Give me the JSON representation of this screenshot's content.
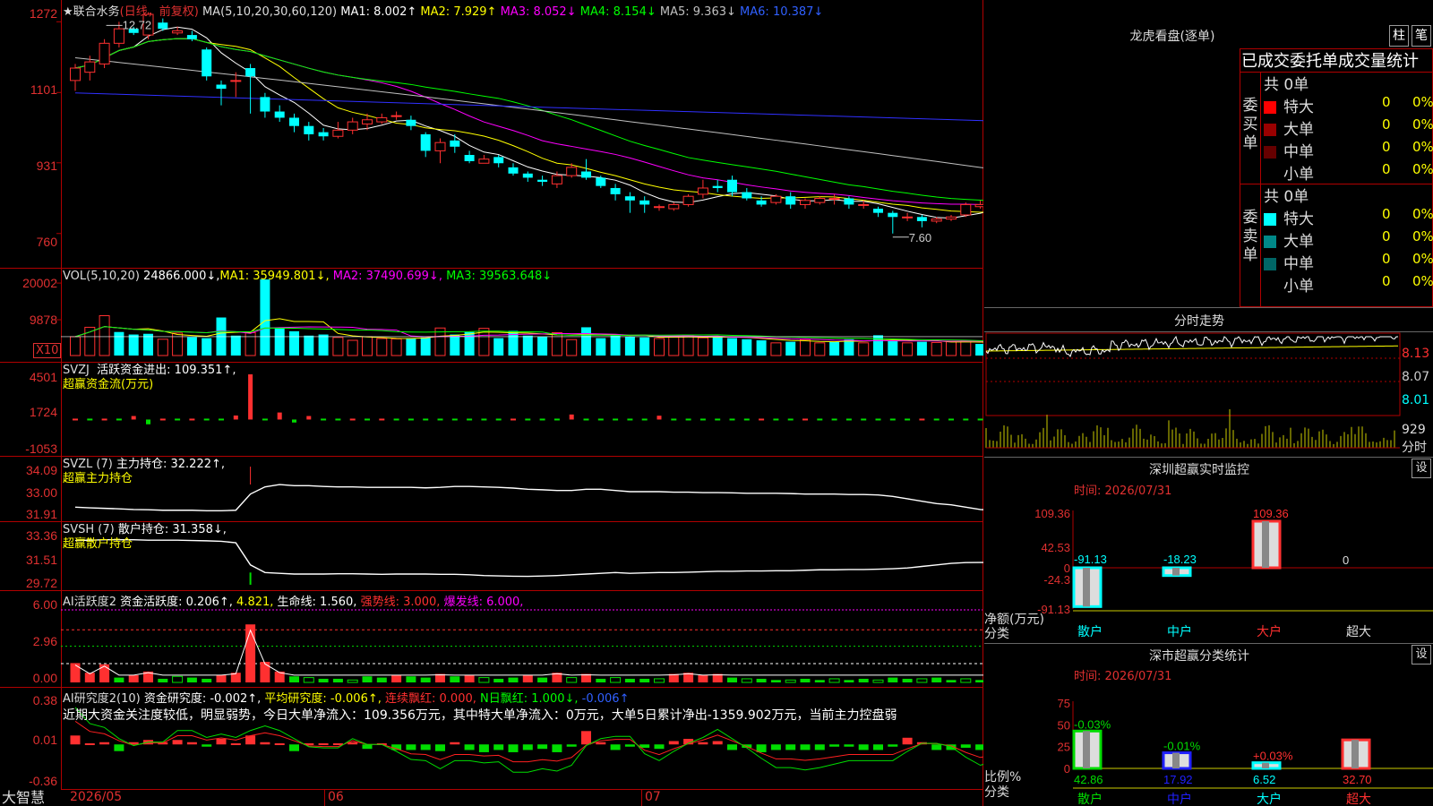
{
  "chart_header": {
    "stock_name": "★联合水务",
    "period": "(日线，前复权)",
    "ma_params": "MA(5,10,20,30,60,120)",
    "ma1": "MA1: 8.002↑",
    "ma2": "MA2: 7.929↑",
    "ma3": "MA3: 8.052↓",
    "ma4": "MA4: 8.154↓",
    "ma5": "MA5: 9.363↓",
    "ma6": "MA6: 10.387↓"
  },
  "colors": {
    "up": "#ff3030",
    "down": "#00ffff",
    "ma1": "#ffffff",
    "ma2": "#ffff00",
    "ma3": "#ff00ff",
    "ma4": "#00ff00",
    "ma5": "#c0c0c0",
    "ma6": "#3030ff"
  },
  "price_axis": [
    "1272",
    "1101",
    "931",
    "760"
  ],
  "price_high_label": "12.72",
  "price_low_label": "7.60",
  "vol_header": {
    "name": "VOL(5,10,20)",
    "val": "24866.000↓,",
    "ma1": "MA1: 35949.801↓,",
    "ma2": "MA2: 37490.699↓,",
    "ma3": "MA3: 39563.648↓"
  },
  "vol_axis": [
    "20002",
    "9878"
  ],
  "vol_unit": "X10",
  "svzj_header": {
    "name": "SVZJ",
    "label": "活跃资金进出: 109.351↑,",
    "sub": "超赢资金流(万元)"
  },
  "svzj_axis": [
    "4501",
    "1724",
    "-1053"
  ],
  "svzl_header": {
    "name": "SVZL (7)",
    "label": "主力持仓: 32.222↑,",
    "sub": "超赢主力持仓"
  },
  "svzl_axis": [
    "34.09",
    "33.00",
    "31.91"
  ],
  "svsh_header": {
    "name": "SVSH (7)",
    "label": "散户持仓: 31.358↓,",
    "sub": "超赢散户持仓"
  },
  "svsh_axis": [
    "33.36",
    "31.51",
    "29.72"
  ],
  "ai1_header": {
    "name": "AI活跃度2",
    "label": "资金活跃度: 0.206↑,",
    "v2": "4.821,",
    "v3": "生命线: 1.560,",
    "v4": "强势线: 3.000,",
    "v5": "爆发线: 6.000,"
  },
  "ai1_axis": [
    "6.00",
    "2.96",
    "0.00"
  ],
  "ai2_header": {
    "name": "AI研究度2(10)",
    "label": "资金研究度: -0.002↑,",
    "v2": "平均研究度: -0.006↑,",
    "v3": "连续飘红: 0.000,",
    "v4": "N日飘红: 1.000↓,",
    "v5": "-0.006↑"
  },
  "ai2_text": "近期大资金关注度较低，明显弱势，今日大单净流入：109.356万元，其中特大单净流入：0万元，大单5日累计净出-1359.902万元，当前主力控盘弱",
  "ai2_axis": [
    "0.38",
    "0.01",
    "-0.36"
  ],
  "date_labels": [
    "2026/05",
    "06",
    "07"
  ],
  "logo": "大智慧",
  "right_panel": {
    "dragon_title": "龙虎看盘(逐单)",
    "tabs": [
      "柱",
      "笔"
    ],
    "stat_title": "已成交委托单成交量统计",
    "buy_label": "委买单",
    "sell_label": "委卖单",
    "buy_total": "共 0单",
    "sell_total": "共 0单",
    "buy_rows": [
      {
        "name": "特大",
        "count": "0",
        "pct": "0%",
        "color": "#ff0000"
      },
      {
        "name": "大单",
        "count": "0",
        "pct": "0%",
        "color": "#990000"
      },
      {
        "name": "中单",
        "count": "0",
        "pct": "0%",
        "color": "#660000"
      },
      {
        "name": "小单",
        "count": "0",
        "pct": "0%",
        "color": "#000000"
      }
    ],
    "sell_rows": [
      {
        "name": "特大",
        "count": "0",
        "pct": "0%",
        "color": "#00ffff"
      },
      {
        "name": "大单",
        "count": "0",
        "pct": "0%",
        "color": "#008888"
      },
      {
        "name": "中单",
        "count": "0",
        "pct": "0%",
        "color": "#006666"
      },
      {
        "name": "小单",
        "count": "0",
        "pct": "0%",
        "color": "#000000"
      }
    ],
    "intraday_title": "分时走势",
    "intraday_axis": [
      "8.13",
      "8.07",
      "8.01"
    ],
    "intraday_vol": "929",
    "intraday_unit": "分时",
    "monitor_title": "深圳超赢实时监控",
    "monitor_btn": "设",
    "monitor_time": "时间: 2026/07/31",
    "monitor_axis": [
      "109.36",
      "42.53",
      "0",
      "-24.3",
      "-91.13"
    ],
    "monitor_values": [
      "-91.13",
      "-18.23",
      "109.36",
      "0"
    ],
    "monitor_cats": [
      "散户",
      "中户",
      "大户",
      "超大"
    ],
    "monitor_ylabel": "净额(万元)",
    "monitor_xlabel": "分类",
    "class_title": "深市超赢分类统计",
    "class_btn": "设",
    "class_time": "时间: 2026/07/31",
    "class_axis": [
      "75",
      "50",
      "25",
      "0"
    ],
    "class_changes": [
      "-0.03%",
      "-0.01%",
      "+0.03%",
      ""
    ],
    "class_values": [
      "42.86",
      "17.92",
      "6.52",
      "32.70"
    ],
    "class_cats": [
      "散户",
      "中户",
      "大户",
      "超大"
    ],
    "class_ylabel": "比例%",
    "class_xlabel": "分类"
  },
  "chart_data": [
    {
      "type": "candlestick",
      "title": "联合水务",
      "ylim": [
        7.4,
        12.9
      ],
      "y_ticks": [
        12.72,
        11.01,
        9.31,
        7.6
      ],
      "candles": [
        [
          11.3,
          11.6,
          11.05,
          11.7
        ],
        [
          11.5,
          11.75,
          11.3,
          11.9
        ],
        [
          11.7,
          12.2,
          11.6,
          12.3
        ],
        [
          12.2,
          12.55,
          12.1,
          12.72
        ],
        [
          12.55,
          12.45,
          12.4,
          12.6
        ],
        [
          12.4,
          12.9,
          12.3,
          12.95
        ],
        [
          12.7,
          12.55,
          12.5,
          12.8
        ],
        [
          12.45,
          12.5,
          12.4,
          12.6
        ],
        [
          12.4,
          12.3,
          12.25,
          12.5
        ],
        [
          12.05,
          11.4,
          11.3,
          12.1
        ],
        [
          11.2,
          11.1,
          10.7,
          11.3
        ],
        [
          11.3,
          11.3,
          10.9,
          11.5
        ],
        [
          11.6,
          11.4,
          10.5,
          11.7
        ],
        [
          10.9,
          10.55,
          10.4,
          11.0
        ],
        [
          10.55,
          10.4,
          10.3,
          10.7
        ],
        [
          10.4,
          10.2,
          10.05,
          10.5
        ],
        [
          10.2,
          10.0,
          9.85,
          10.3
        ],
        [
          10.05,
          9.95,
          9.85,
          10.15
        ],
        [
          9.95,
          10.1,
          9.9,
          10.3
        ],
        [
          10.1,
          10.3,
          10.0,
          10.4
        ],
        [
          10.25,
          10.35,
          10.1,
          10.5
        ],
        [
          10.3,
          10.4,
          10.25,
          10.5
        ],
        [
          10.45,
          10.45,
          10.35,
          10.55
        ],
        [
          10.35,
          10.2,
          10.1,
          10.45
        ],
        [
          10.0,
          9.6,
          9.45,
          10.05
        ],
        [
          9.6,
          9.8,
          9.3,
          9.9
        ],
        [
          9.85,
          9.7,
          9.55,
          10.0
        ],
        [
          9.5,
          9.35,
          9.3,
          9.6
        ],
        [
          9.3,
          9.4,
          9.3,
          9.5
        ],
        [
          9.45,
          9.3,
          9.2,
          9.5
        ],
        [
          9.2,
          9.05,
          9.0,
          9.3
        ],
        [
          9.05,
          8.95,
          8.85,
          9.1
        ],
        [
          8.9,
          8.85,
          8.75,
          9.0
        ],
        [
          8.8,
          9.0,
          8.7,
          9.1
        ],
        [
          9.0,
          9.2,
          8.95,
          9.3
        ],
        [
          9.1,
          8.95,
          8.9,
          9.4
        ],
        [
          8.95,
          8.75,
          8.7,
          9.0
        ],
        [
          8.7,
          8.55,
          8.4,
          8.8
        ],
        [
          8.5,
          8.4,
          8.1,
          8.6
        ],
        [
          8.4,
          8.3,
          8.1,
          8.5
        ],
        [
          8.25,
          8.25,
          8.15,
          8.3
        ],
        [
          8.2,
          8.3,
          8.15,
          8.35
        ],
        [
          8.3,
          8.5,
          8.25,
          8.55
        ],
        [
          8.55,
          8.7,
          8.45,
          8.9
        ],
        [
          8.75,
          8.7,
          8.6,
          8.9
        ],
        [
          8.9,
          8.6,
          8.5,
          9.0
        ],
        [
          8.6,
          8.45,
          8.4,
          8.7
        ],
        [
          8.4,
          8.3,
          8.25,
          8.5
        ],
        [
          8.35,
          8.5,
          8.3,
          8.55
        ],
        [
          8.5,
          8.3,
          8.2,
          8.6
        ],
        [
          8.3,
          8.4,
          8.2,
          8.45
        ],
        [
          8.35,
          8.45,
          8.3,
          8.5
        ],
        [
          8.45,
          8.45,
          8.3,
          8.55
        ],
        [
          8.45,
          8.3,
          8.2,
          8.5
        ],
        [
          8.3,
          8.3,
          8.2,
          8.4
        ],
        [
          8.2,
          8.1,
          8.0,
          8.25
        ],
        [
          8.1,
          8.0,
          7.6,
          8.15
        ],
        [
          8.0,
          8.0,
          7.9,
          8.1
        ],
        [
          8.0,
          7.9,
          7.75,
          8.05
        ],
        [
          7.9,
          7.95,
          7.85,
          8.0
        ],
        [
          7.95,
          8.0,
          7.9,
          8.05
        ],
        [
          8.05,
          8.3,
          8.0,
          8.35
        ],
        [
          8.25,
          8.3,
          8.2,
          8.4
        ],
        [
          8.3,
          8.35,
          8.25,
          8.4
        ]
      ]
    },
    {
      "type": "bar",
      "title": "VOL",
      "ylim": [
        0,
        22000
      ],
      "y_ticks": [
        20002,
        9878
      ],
      "values": [
        5200,
        7800,
        11000,
        6500,
        5800,
        6000,
        4500,
        6200,
        5100,
        4800,
        10500,
        5500,
        6300,
        21000,
        7500,
        6700,
        5500,
        5800,
        5000,
        4200,
        5200,
        4700,
        4600,
        4800,
        5000,
        7600,
        5800,
        6500,
        7500,
        4800,
        6800,
        5500,
        5200,
        6300,
        4400,
        7800,
        4800,
        5500,
        5200,
        5000,
        4700,
        5100,
        5600,
        4900,
        5200,
        4800,
        4500,
        4200,
        3500,
        3800,
        4400,
        3500,
        3800,
        4500,
        3500,
        5600,
        4000,
        3500,
        3800,
        3600,
        3800,
        4200,
        3200,
        3300
      ],
      "up": [
        1,
        1,
        1,
        0,
        0,
        0,
        1,
        1,
        0,
        0,
        0,
        0,
        1,
        0,
        0,
        0,
        0,
        0,
        1,
        1,
        1,
        1,
        1,
        0,
        0,
        1,
        0,
        0,
        1,
        0,
        0,
        0,
        0,
        1,
        1,
        0,
        0,
        0,
        0,
        0,
        1,
        1,
        1,
        1,
        0,
        0,
        0,
        0,
        1,
        0,
        1,
        1,
        0,
        0,
        1,
        0,
        0,
        1,
        0,
        1,
        1,
        1,
        0,
        1
      ]
    },
    {
      "type": "bar",
      "title": "SVZJ",
      "ylim": [
        -1053,
        4501
      ],
      "values": [
        100,
        -80,
        200,
        -150,
        350,
        -400,
        180,
        -120,
        150,
        -100,
        -60,
        400,
        4501,
        -80,
        700,
        -250,
        350,
        -180,
        -120,
        80,
        -150,
        120,
        -100,
        -80,
        -120,
        -100,
        -90,
        -60,
        -100,
        -120,
        90,
        -100,
        -80,
        -150,
        500,
        -120,
        -100,
        -140,
        -200,
        -180,
        380,
        -200,
        -120,
        -100,
        -100,
        -130,
        -90,
        120,
        -150,
        -100,
        80,
        -100,
        -120,
        -180,
        -100,
        -80,
        -150,
        -120,
        80,
        -100,
        -80,
        -150,
        -60,
        -80
      ],
      "annotation": "109.351"
    },
    {
      "type": "line",
      "title": "SVZL",
      "ylim": [
        31.91,
        34.09
      ],
      "values": [
        32.35,
        32.32,
        32.3,
        32.28,
        32.25,
        32.24,
        32.22,
        32.22,
        32.22,
        32.2,
        32.2,
        32.22,
        32.9,
        33.2,
        33.3,
        33.25,
        33.25,
        33.22,
        33.2,
        33.2,
        33.18,
        33.18,
        33.18,
        33.18,
        33.16,
        33.18,
        33.22,
        33.22,
        33.2,
        33.18,
        33.15,
        33.1,
        33.08,
        33.05,
        33.05,
        33.1,
        33.1,
        33.05,
        33.0,
        33.0,
        33.0,
        32.98,
        32.98,
        32.96,
        32.96,
        32.95,
        32.93,
        32.93,
        32.93,
        32.92,
        32.9,
        32.9,
        32.9,
        32.88,
        32.88,
        32.86,
        32.8,
        32.7,
        32.6,
        32.5,
        32.45,
        32.35,
        32.25,
        32.22
      ]
    },
    {
      "type": "line",
      "title": "SVSH",
      "ylim": [
        29.72,
        33.36
      ],
      "values": [
        32.8,
        32.82,
        32.85,
        32.85,
        32.85,
        32.82,
        32.82,
        32.82,
        32.8,
        32.78,
        32.75,
        32.65,
        31.2,
        30.7,
        30.65,
        30.6,
        30.6,
        30.6,
        30.62,
        30.62,
        30.6,
        30.58,
        30.6,
        30.6,
        30.6,
        30.58,
        30.58,
        30.55,
        30.5,
        30.48,
        30.46,
        30.45,
        30.47,
        30.5,
        30.55,
        30.6,
        30.65,
        30.7,
        30.65,
        30.68,
        30.7,
        30.7,
        30.72,
        30.75,
        30.78,
        30.78,
        30.8,
        30.8,
        30.82,
        30.82,
        30.85,
        30.88,
        30.88,
        30.9,
        30.9,
        30.92,
        30.95,
        31.0,
        31.1,
        31.2,
        31.3,
        31.35,
        31.36,
        31.36
      ]
    },
    {
      "type": "bar",
      "title": "AI活跃度2",
      "ylim": [
        0,
        6.3
      ],
      "values": [
        1.6,
        0.8,
        1.5,
        0.4,
        0.6,
        0.9,
        0.3,
        0.5,
        0.4,
        0.3,
        0.6,
        0.8,
        4.8,
        1.7,
        0.9,
        0.5,
        0.4,
        0.3,
        0.3,
        0.2,
        0.5,
        0.4,
        0.6,
        0.5,
        0.4,
        0.7,
        0.5,
        0.6,
        0.4,
        0.3,
        0.4,
        0.6,
        0.4,
        0.8,
        0.4,
        0.7,
        0.3,
        0.4,
        0.3,
        0.3,
        0.3,
        0.7,
        0.8,
        0.6,
        0.7,
        0.4,
        0.3,
        0.3,
        0.2,
        0.2,
        0.3,
        0.2,
        0.3,
        0.2,
        0.3,
        0.2,
        0.4,
        0.3,
        0.3,
        0.4,
        0.2,
        0.3,
        0.2,
        0.2
      ],
      "lines": {
        "life": 1.56,
        "strong": 3.0,
        "burst": 6.0
      }
    },
    {
      "type": "bar",
      "title": "AI研究度2",
      "ylim": [
        -0.36,
        0.38
      ],
      "values": [
        0.08,
        0.01,
        0.02,
        -0.06,
        0.02,
        0.04,
        0.02,
        0.04,
        0.02,
        -0.02,
        0.05,
        0.01,
        0.08,
        0.02,
        0.01,
        -0.06,
        0.01,
        0.01,
        0.01,
        0.02,
        -0.04,
        0.01,
        -0.05,
        -0.05,
        -0.05,
        -0.06,
        0.02,
        -0.05,
        -0.07,
        -0.05,
        -0.07,
        -0.05,
        -0.04,
        -0.07,
        -0.02,
        0.12,
        0.02,
        -0.05,
        -0.02,
        -0.03,
        -0.04,
        0.03,
        0.05,
        0.02,
        0.03,
        -0.05,
        -0.03,
        -0.07,
        -0.05,
        -0.05,
        -0.05,
        -0.05,
        -0.02,
        -0.02,
        -0.05,
        -0.05,
        -0.02,
        0.06,
        0.02,
        -0.05,
        -0.05,
        -0.03,
        -0.05,
        -0.01
      ]
    }
  ]
}
